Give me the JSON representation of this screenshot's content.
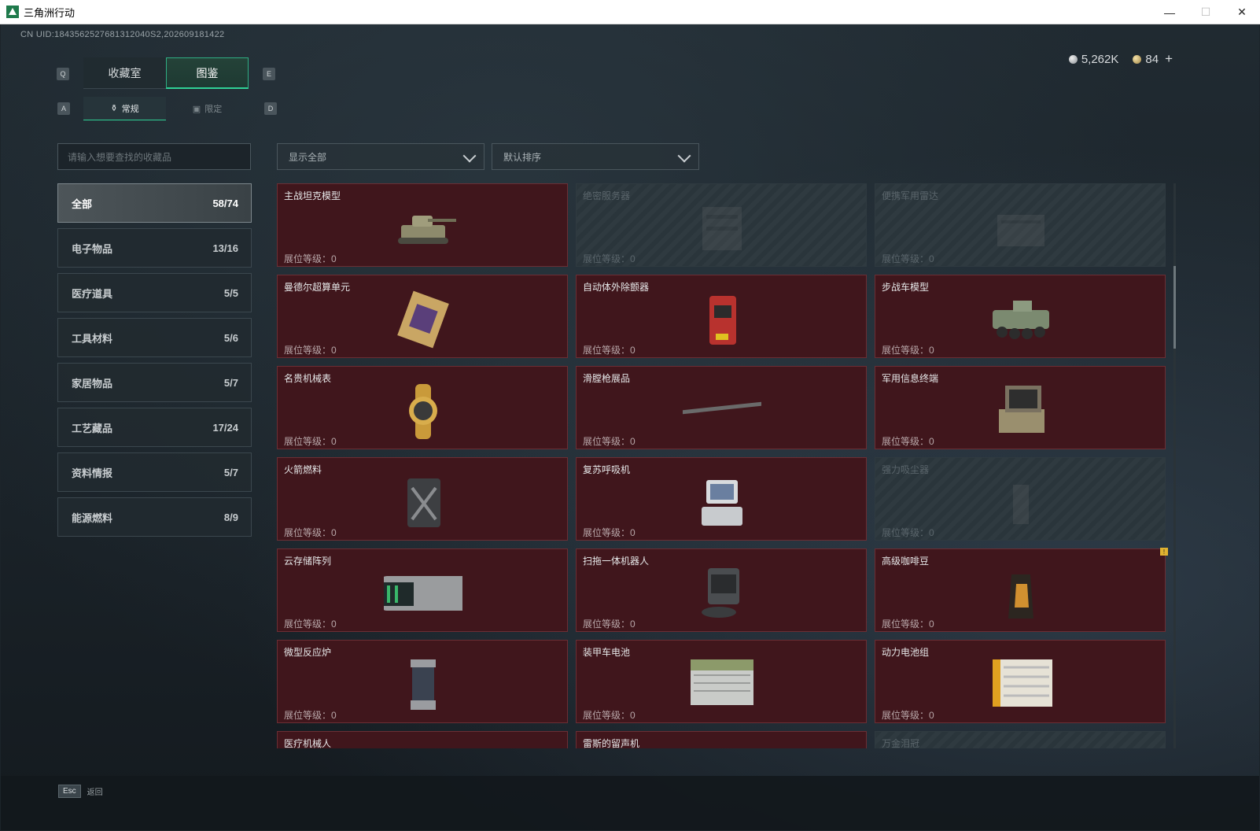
{
  "window": {
    "title": "三角洲行动",
    "minimize": "—",
    "maximize": "☐",
    "close": "✕"
  },
  "uid": "CN UID:1843562527681312040S2,202609181422",
  "currency": {
    "silver": "5,262K",
    "gold": "84",
    "plus": "+"
  },
  "keys": {
    "prev_tab": "Q",
    "next_tab": "E",
    "prev_sub": "A",
    "next_sub": "D"
  },
  "tabs": [
    {
      "label": "收藏室"
    },
    {
      "label": "图鉴"
    }
  ],
  "subtabs": [
    {
      "label": "常规"
    },
    {
      "label": "限定"
    }
  ],
  "search": {
    "placeholder": "请输入想要查找的收藏品"
  },
  "filters": {
    "show": "显示全部",
    "sort": "默认排序"
  },
  "categories": [
    {
      "label": "全部",
      "count": "58/74"
    },
    {
      "label": "电子物品",
      "count": "13/16"
    },
    {
      "label": "医疗道具",
      "count": "5/5"
    },
    {
      "label": "工具材料",
      "count": "5/6"
    },
    {
      "label": "家居物品",
      "count": "5/7"
    },
    {
      "label": "工艺藏品",
      "count": "17/24"
    },
    {
      "label": "资料情报",
      "count": "5/7"
    },
    {
      "label": "能源燃料",
      "count": "8/9"
    }
  ],
  "level_label": "展位等级：0",
  "items": [
    {
      "name": "主战坦克模型",
      "icon": "tank-model-icon",
      "locked": false
    },
    {
      "name": "绝密服务器",
      "icon": "server-icon",
      "locked": true
    },
    {
      "name": "便携军用雷达",
      "icon": "radar-icon",
      "locked": true
    },
    {
      "name": "曼德尔超算单元",
      "icon": "supercomputer-chip-icon",
      "locked": false
    },
    {
      "name": "自动体外除颤器",
      "icon": "defibrillator-icon",
      "locked": false
    },
    {
      "name": "步战车模型",
      "icon": "ifv-model-icon",
      "locked": false
    },
    {
      "name": "名贵机械表",
      "icon": "watch-icon",
      "locked": false
    },
    {
      "name": "滑膛枪展品",
      "icon": "musket-icon",
      "locked": false
    },
    {
      "name": "军用信息终端",
      "icon": "terminal-icon",
      "locked": false
    },
    {
      "name": "火箭燃料",
      "icon": "fuel-can-icon",
      "locked": false
    },
    {
      "name": "复苏呼吸机",
      "icon": "ventilator-icon",
      "locked": false
    },
    {
      "name": "强力吸尘器",
      "icon": "vacuum-icon",
      "locked": true
    },
    {
      "name": "云存储阵列",
      "icon": "storage-array-icon",
      "locked": false
    },
    {
      "name": "扫拖一体机器人",
      "icon": "robot-vacuum-icon",
      "locked": false
    },
    {
      "name": "高级咖啡豆",
      "icon": "coffee-bag-icon",
      "locked": false
    },
    {
      "name": "微型反应炉",
      "icon": "reactor-icon",
      "locked": false
    },
    {
      "name": "装甲车电池",
      "icon": "battery-icon",
      "locked": false
    },
    {
      "name": "动力电池组",
      "icon": "battery-pack-icon",
      "locked": false
    },
    {
      "name": "医疗机械人",
      "icon": "medical-robot-icon",
      "locked": false
    },
    {
      "name": "雷斯的留声机",
      "icon": "gramophone-icon",
      "locked": false
    },
    {
      "name": "万金泪冠",
      "icon": "crown-icon",
      "locked": true
    }
  ],
  "warning_badge": "!",
  "footer": {
    "key": "Esc",
    "label": "返回"
  }
}
